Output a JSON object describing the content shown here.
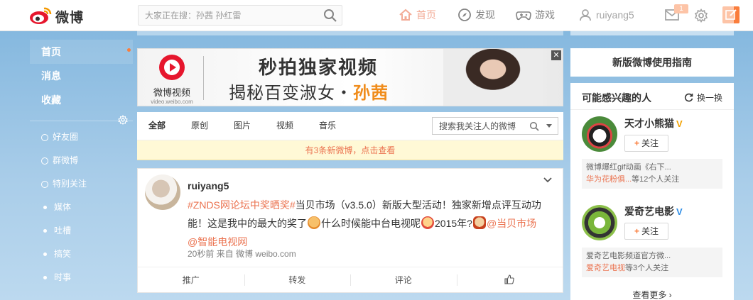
{
  "topbar": {
    "logo_text": "微博",
    "search_placeholder": "大家正在搜：孙茜 孙红雷",
    "nav": {
      "home": "首页",
      "discover": "发现",
      "games": "游戏",
      "username": "ruiyang5",
      "message_badge": "1"
    },
    "accent_color": "#eb7350"
  },
  "left_nav": {
    "main": [
      "首页",
      "消息",
      "收藏"
    ],
    "groups": [
      {
        "label": "好友圈",
        "icon": "circle-icon"
      },
      {
        "label": "群微博",
        "icon": "group-icon"
      },
      {
        "label": "特别关注",
        "icon": "star-icon"
      }
    ],
    "categories": [
      "媒体",
      "吐槽",
      "搞笑",
      "时事"
    ]
  },
  "banner": {
    "logo_name": "微博视频",
    "logo_site": "video.weibo.com",
    "headline": "秒拍独家视频",
    "subline_prefix": "揭秘百变淑女・",
    "subline_highlight": "孙茜",
    "close": "✕"
  },
  "feed": {
    "tabs": [
      "全部",
      "原创",
      "图片",
      "视频",
      "音乐"
    ],
    "search_placeholder": "搜索我关注人的微博",
    "new_notice": "有3条新微博，点击查看",
    "post": {
      "author": "ruiyang5",
      "tag": "#ZNDS网论坛中奖晒奖#",
      "text_1": "当贝市场（v3.5.0）新版大型活动！独家新增点评互动功能！这是我中的最大的奖了",
      "text_2": "什么时候能中台电视呢",
      "text_3": "2015年?",
      "mention_1": "@当贝市场",
      "mention_2": "@智能电视网",
      "meta": "20秒前 来自 微博 weibo.com",
      "actions": [
        "推广",
        "转发",
        "评论",
        "👍"
      ]
    }
  },
  "right": {
    "guide": "新版微博使用指南",
    "recommend_title": "可能感兴趣的人",
    "refresh": "换一换",
    "users": [
      {
        "name": "天才小熊猫",
        "badge": "V",
        "follow": "关注",
        "reason_1": "微博爆红gif动画《右下...",
        "reason_link": "华为花粉俱...",
        "reason_2": "等12个人关注"
      },
      {
        "name": "爱奇艺电影",
        "badge": "V",
        "follow": "关注",
        "reason_1": "爱奇艺电影频道官方微...",
        "reason_link": "爱奇艺电视",
        "reason_2": "等3个人关注"
      }
    ],
    "more": "查看更多 ›"
  }
}
